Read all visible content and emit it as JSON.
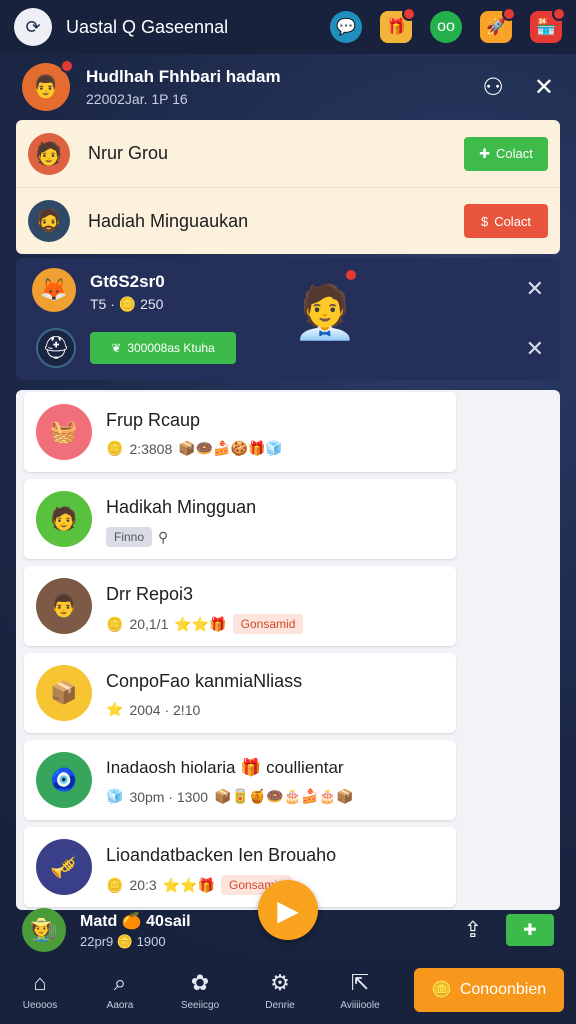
{
  "app": {
    "title": "Uastal Q Gaseennal"
  },
  "top_icons": [
    "chat-icon",
    "gift-icon",
    "binoculars-icon",
    "rocket-icon",
    "store-icon"
  ],
  "profile": {
    "name": "Hudlhah Fhhbari hadam",
    "sub": "22002Jar. 1P 16"
  },
  "cream_rows": [
    {
      "label": "Nrur Grou",
      "button": "Colact",
      "color": "#3fbb4b"
    },
    {
      "label": "Hadiah Minguaukan",
      "button": "Colact",
      "color": "#e9553c"
    }
  ],
  "notification": {
    "title": "Gt6S2sr0",
    "sub": "T5 · 🪙 250",
    "button": "300008as Ktuha"
  },
  "list": [
    {
      "title": "Frup Rcaup",
      "sub": "2:3808",
      "emoji": "📦🍩🍰🍪🎁🧊",
      "bg": "#f06f7a"
    },
    {
      "title": "Hadikah Mingguan",
      "sub": "",
      "tag": "Finno",
      "tagtype": "grey",
      "bg": "#58c23f"
    },
    {
      "title": "Drr Repoi3",
      "sub": "20,1/1",
      "emoji": "⭐⭐🎁",
      "tag": "Gonsamid",
      "tagtype": "pink",
      "bg": "#7c5a46"
    },
    {
      "title": "ConpoFao kanmiaNliass",
      "sub": "2004 · 2!10",
      "emoji": "",
      "bg": "#f6c531"
    },
    {
      "title": "Inadaosh hiolaria 🎁 coullientar",
      "sub": "30pm · 1300",
      "emoji": "📦🥫🍯🍩🎂🍰🎂📦",
      "bg": "#37a55b"
    },
    {
      "title": "Lioandatbacken Ien Brouaho",
      "sub": "20:3",
      "emoji": "⭐⭐🎁",
      "tag": "Gonsamid",
      "tagtype": "pink",
      "bg": "#3a3f8a"
    }
  ],
  "mini_profile": {
    "name": "Matd 🍊 40sail",
    "sub": "22pr9 🪙 1900"
  },
  "nav": [
    "Ueooos",
    "Aaora",
    "Seeiicgo",
    "Denrie",
    "Aviiiioole"
  ],
  "cta": "Conoonbien"
}
